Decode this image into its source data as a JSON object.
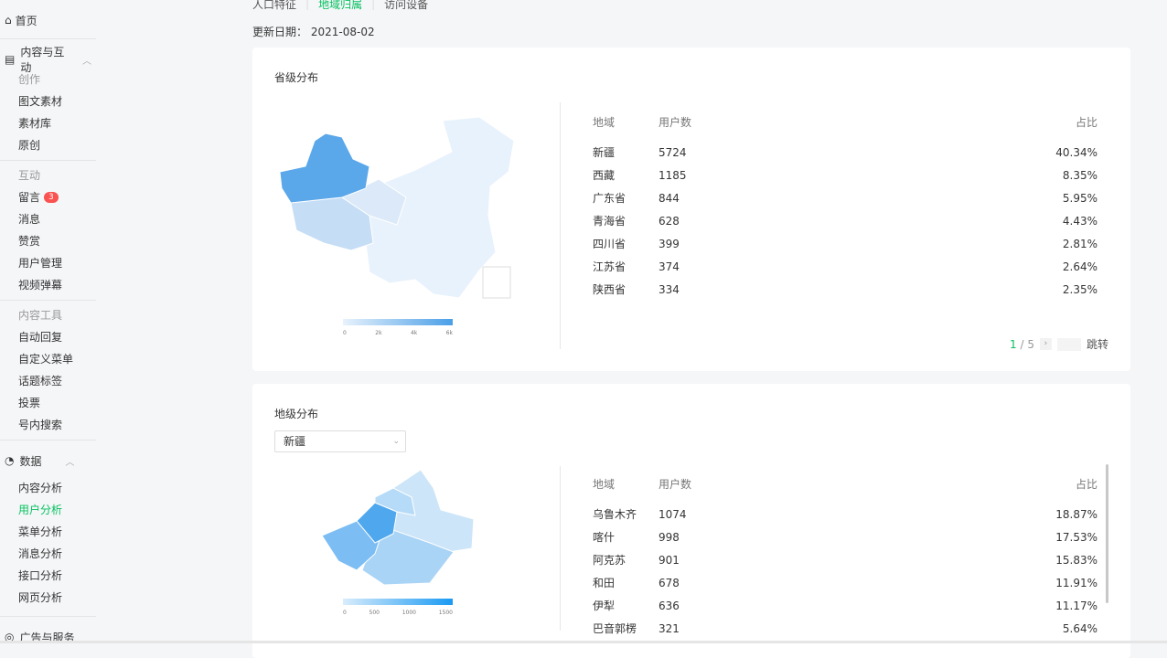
{
  "sidebar": {
    "home": "首页",
    "groups": [
      {
        "label": "内容与互动",
        "sections": [
          {
            "title": "创作",
            "items": [
              "图文素材",
              "素材库",
              "原创"
            ]
          },
          {
            "title": "互动",
            "items": [
              "留言",
              "消息",
              "赞赏",
              "用户管理",
              "视频弹幕"
            ]
          },
          {
            "title": "内容工具",
            "items": [
              "自动回复",
              "自定义菜单",
              "话题标签",
              "投票",
              "号内搜索"
            ]
          }
        ]
      },
      {
        "label": "数据",
        "items": [
          "内容分析",
          "用户分析",
          "菜单分析",
          "消息分析",
          "接口分析",
          "网页分析"
        ]
      },
      {
        "label": "广告与服务"
      }
    ],
    "message_badge": "3",
    "active_item": "用户分析"
  },
  "tabs": [
    "人口特征",
    "地域归属",
    "访问设备"
  ],
  "active_tab": "地域归属",
  "update_date_label": "更新日期：",
  "update_date": "2021-08-02",
  "province": {
    "title": "省级分布",
    "legend_ticks": [
      "0",
      "2k",
      "4k",
      "6k"
    ],
    "headers": [
      "地域",
      "用户数",
      "占比"
    ],
    "rows": [
      [
        "新疆",
        "5724",
        "40.34%"
      ],
      [
        "西藏",
        "1185",
        "8.35%"
      ],
      [
        "广东省",
        "844",
        "5.95%"
      ],
      [
        "青海省",
        "628",
        "4.43%"
      ],
      [
        "四川省",
        "399",
        "2.81%"
      ],
      [
        "江苏省",
        "374",
        "2.64%"
      ],
      [
        "陕西省",
        "334",
        "2.35%"
      ]
    ],
    "page_current": "1",
    "page_sep": "/",
    "page_total": "5",
    "jump_label": "跳转"
  },
  "city": {
    "title": "地级分布",
    "selected": "新疆",
    "legend_ticks": [
      "0",
      "500",
      "1000",
      "1500"
    ],
    "headers": [
      "地域",
      "用户数",
      "占比"
    ],
    "rows": [
      [
        "乌鲁木齐",
        "1074",
        "18.87%"
      ],
      [
        "喀什",
        "998",
        "17.53%"
      ],
      [
        "阿克苏",
        "901",
        "15.83%"
      ],
      [
        "和田",
        "678",
        "11.91%"
      ],
      [
        "伊犁",
        "636",
        "11.17%"
      ],
      [
        "巴音郭楞",
        "321",
        "5.64%"
      ]
    ]
  },
  "colors": {
    "accent": "#07c160",
    "map_high": "#4a9fe8",
    "map_low": "#e8f2fc"
  }
}
